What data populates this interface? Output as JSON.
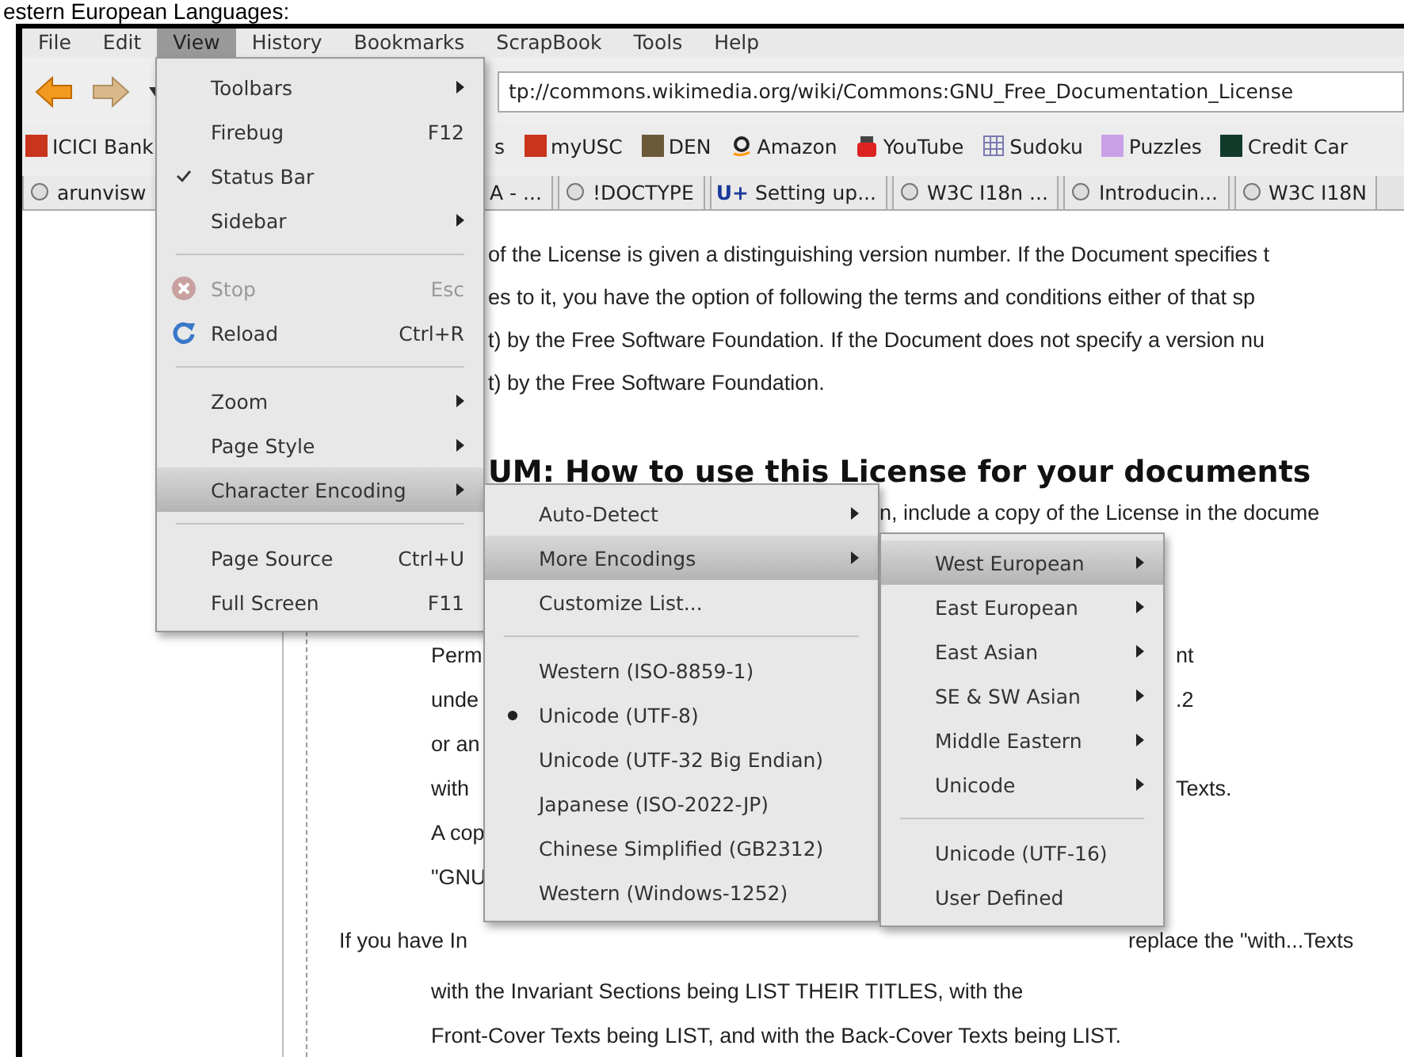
{
  "caption": "estern European Languages:",
  "menubar": [
    {
      "label": "File",
      "selected": false
    },
    {
      "label": "Edit",
      "selected": false
    },
    {
      "label": "View",
      "selected": true
    },
    {
      "label": "History",
      "selected": false
    },
    {
      "label": "Bookmarks",
      "selected": false
    },
    {
      "label": "ScrapBook",
      "selected": false
    },
    {
      "label": "Tools",
      "selected": false
    },
    {
      "label": "Help",
      "selected": false
    }
  ],
  "address": "tp://commons.wikimedia.org/wiki/Commons:GNU_Free_Documentation_License",
  "bookmarks_left": [
    {
      "label": "ICICI Bank",
      "kind": "red"
    }
  ],
  "bookmarks_right": [
    {
      "label": "s",
      "kind": "plain"
    },
    {
      "label": "myUSC",
      "kind": "red"
    },
    {
      "label": "DEN",
      "kind": "brown"
    },
    {
      "label": "Amazon",
      "kind": "letter"
    },
    {
      "label": "YouTube",
      "kind": "tv"
    },
    {
      "label": "Sudoku",
      "kind": "grid"
    },
    {
      "label": "Puzzles",
      "kind": "puzzle"
    },
    {
      "label": "Credit Car",
      "kind": "dark"
    }
  ],
  "tabs_left": [
    {
      "label": "arunvisw",
      "kind": "page"
    }
  ],
  "tabs_right": [
    {
      "label": "A - ...",
      "kind": "plain"
    },
    {
      "label": "!DOCTYPE",
      "kind": "page"
    },
    {
      "label": "Setting up...",
      "kind": "badge",
      "badge": "U+"
    },
    {
      "label": "W3C I18n ...",
      "kind": "page"
    },
    {
      "label": "Introducin...",
      "kind": "page"
    },
    {
      "label": "W3C I18N",
      "kind": "page"
    }
  ],
  "content": [
    {
      "kind": "para",
      "left": "of the License is given a distinguishing version number. If the Document specifies t"
    },
    {
      "kind": "para",
      "left": "es to it, you have the option of following the terms and conditions either of that sp"
    },
    {
      "kind": "para",
      "left": "t) by the Free Software Foundation. If the Document does not specify a version nu"
    },
    {
      "kind": "para",
      "left": "t) by the Free Software Foundation."
    },
    {
      "kind": "gap"
    },
    {
      "kind": "heading",
      "left": "UM: How to use this License for your documents"
    },
    {
      "kind": "continued",
      "left": "n, include a copy of the License in the docume"
    },
    {
      "kind": "gap"
    },
    {
      "kind": "gap"
    },
    {
      "kind": "quote",
      "left": "Perm",
      "right": "nt"
    },
    {
      "kind": "quote",
      "left": "unde",
      "right": ".2"
    },
    {
      "kind": "quote",
      "left": "or an"
    },
    {
      "kind": "quote",
      "left": "with",
      "right": "Texts."
    },
    {
      "kind": "quote",
      "left": "A cop"
    },
    {
      "kind": "quote",
      "left": "\"GNU"
    },
    {
      "kind": "text",
      "left": "If you have In",
      "right": "replace the \"with...Texts"
    },
    {
      "kind": "quote",
      "left": "with the Invariant Sections being LIST THEIR TITLES, with the"
    },
    {
      "kind": "quote",
      "left": "Front-Cover Texts being LIST, and with the Back-Cover Texts being LIST."
    }
  ],
  "menus": [
    {
      "items": [
        {
          "kind": "item",
          "label": "Toolbars",
          "submenu": true,
          "checked": false,
          "highlighted": false,
          "disabled": false
        },
        {
          "kind": "item",
          "label": "Firebug",
          "shortcut": "F12",
          "submenu": false,
          "checked": false,
          "highlighted": false,
          "disabled": false
        },
        {
          "kind": "check",
          "label": "Status Bar",
          "submenu": false,
          "checked": true,
          "highlighted": false,
          "disabled": false
        },
        {
          "kind": "item",
          "label": "Sidebar",
          "submenu": true,
          "checked": false,
          "highlighted": false,
          "disabled": false
        },
        {
          "kind": "separator"
        },
        {
          "kind": "stop",
          "label": "Stop",
          "shortcut": "Esc",
          "submenu": false,
          "checked": false,
          "highlighted": false,
          "disabled": true
        },
        {
          "kind": "reload",
          "label": "Reload",
          "shortcut": "Ctrl+R",
          "submenu": false,
          "checked": false,
          "highlighted": false,
          "disabled": false
        },
        {
          "kind": "separator"
        },
        {
          "kind": "item",
          "label": "Zoom",
          "submenu": true,
          "checked": false,
          "highlighted": false,
          "disabled": false
        },
        {
          "kind": "item",
          "label": "Page Style",
          "submenu": true,
          "checked": false,
          "highlighted": false,
          "disabled": false
        },
        {
          "kind": "item",
          "label": "Character Encoding",
          "submenu": true,
          "checked": false,
          "highlighted": true,
          "disabled": false
        },
        {
          "kind": "separator"
        },
        {
          "kind": "item",
          "label": "Page Source",
          "shortcut": "Ctrl+U",
          "submenu": false,
          "checked": false,
          "highlighted": false,
          "disabled": false
        },
        {
          "kind": "item",
          "label": "Full Screen",
          "shortcut": "F11",
          "submenu": false,
          "checked": false,
          "highlighted": false,
          "disabled": false
        }
      ]
    },
    {
      "items": [
        {
          "kind": "item",
          "label": "Auto-Detect",
          "submenu": true,
          "checked": false,
          "highlighted": false,
          "disabled": false
        },
        {
          "kind": "item",
          "label": "More Encodings",
          "submenu": true,
          "checked": false,
          "highlighted": true,
          "disabled": false
        },
        {
          "kind": "item",
          "label": "Customize List...",
          "submenu": false,
          "checked": false,
          "highlighted": false,
          "disabled": false
        },
        {
          "kind": "separator"
        },
        {
          "kind": "radio",
          "label": "Western (ISO-8859-1)",
          "submenu": false,
          "checked": false,
          "highlighted": false,
          "disabled": false
        },
        {
          "kind": "radio",
          "label": "Unicode (UTF-8)",
          "submenu": false,
          "checked": true,
          "highlighted": false,
          "disabled": false
        },
        {
          "kind": "radio",
          "label": "Unicode (UTF-32 Big Endian)",
          "submenu": false,
          "checked": false,
          "highlighted": false,
          "disabled": false
        },
        {
          "kind": "radio",
          "label": "Japanese (ISO-2022-JP)",
          "submenu": false,
          "checked": false,
          "highlighted": false,
          "disabled": false
        },
        {
          "kind": "radio",
          "label": "Chinese Simplified (GB2312)",
          "submenu": false,
          "checked": false,
          "highlighted": false,
          "disabled": false
        },
        {
          "kind": "radio",
          "label": "Western (Windows-1252)",
          "submenu": false,
          "checked": false,
          "highlighted": false,
          "disabled": false
        }
      ]
    },
    {
      "items": [
        {
          "kind": "item",
          "label": "West European",
          "submenu": true,
          "checked": false,
          "highlighted": true,
          "disabled": false
        },
        {
          "kind": "item",
          "label": "East European",
          "submenu": true,
          "checked": false,
          "highlighted": false,
          "disabled": false
        },
        {
          "kind": "item",
          "label": "East Asian",
          "submenu": true,
          "checked": false,
          "highlighted": false,
          "disabled": false
        },
        {
          "kind": "item",
          "label": "SE & SW Asian",
          "submenu": true,
          "checked": false,
          "highlighted": false,
          "disabled": false
        },
        {
          "kind": "item",
          "label": "Middle Eastern",
          "submenu": true,
          "checked": false,
          "highlighted": false,
          "disabled": false
        },
        {
          "kind": "item",
          "label": "Unicode",
          "submenu": true,
          "checked": false,
          "highlighted": false,
          "disabled": false
        },
        {
          "kind": "separator"
        },
        {
          "kind": "item",
          "label": "Unicode (UTF-16)",
          "submenu": false,
          "checked": false,
          "highlighted": false,
          "disabled": false
        },
        {
          "kind": "item",
          "label": "User Defined",
          "submenu": false,
          "checked": false,
          "highlighted": false,
          "disabled": false
        }
      ]
    }
  ]
}
